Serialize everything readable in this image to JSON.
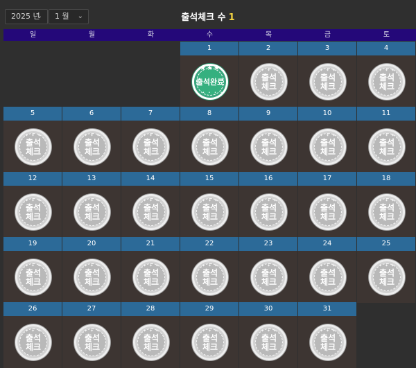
{
  "header": {
    "year_select": "2025 년",
    "month_select": "1 월",
    "title": "출석체크 수",
    "count": "1"
  },
  "weekdays": [
    "일",
    "월",
    "화",
    "수",
    "목",
    "금",
    "토"
  ],
  "stamps": {
    "pending_text": [
      "출석",
      "체크"
    ],
    "done_text": "출석완료"
  },
  "colors": {
    "weekday_bar": "#240879",
    "day_header": "#2c6a98",
    "cell_bg": "#3d3532",
    "done_stamp": "#3aa57e",
    "count_highlight": "#f5d442"
  },
  "calendar": {
    "first_weekday_index": 3,
    "days_in_month": 31,
    "attended_days": [
      1
    ]
  }
}
